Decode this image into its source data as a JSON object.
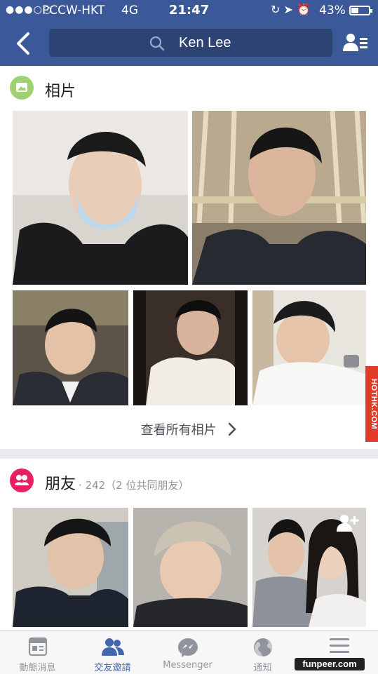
{
  "status_bar": {
    "signal": "●●●○○",
    "carrier": "PCCW-HKT",
    "network": "4G",
    "time": "21:47",
    "battery_pct": "43%",
    "battery_level": 0.43
  },
  "nav": {
    "search_text": "Ken Lee"
  },
  "photos": {
    "title": "相片",
    "see_all": "查看所有相片"
  },
  "friends": {
    "title": "朋友",
    "meta": "· 242（2 位共同朋友）"
  },
  "tabs": [
    {
      "label": "動態消息",
      "icon": "news-feed-icon",
      "active": false
    },
    {
      "label": "交友邀請",
      "icon": "friend-requests-icon",
      "active": true
    },
    {
      "label": "Messenger",
      "icon": "messenger-icon",
      "active": false
    },
    {
      "label": "通知",
      "icon": "globe-icon",
      "active": false
    },
    {
      "label": "",
      "icon": "menu-icon",
      "active": false
    }
  ],
  "watermarks": {
    "side": "HOTHK.COM",
    "corner": "funpeer.com"
  },
  "colors": {
    "brand": "#3b5998",
    "search_bg": "#2d4373",
    "photos_icon": "#9fd171",
    "friends_icon": "#e91e63",
    "active_tab": "#4267b2"
  }
}
